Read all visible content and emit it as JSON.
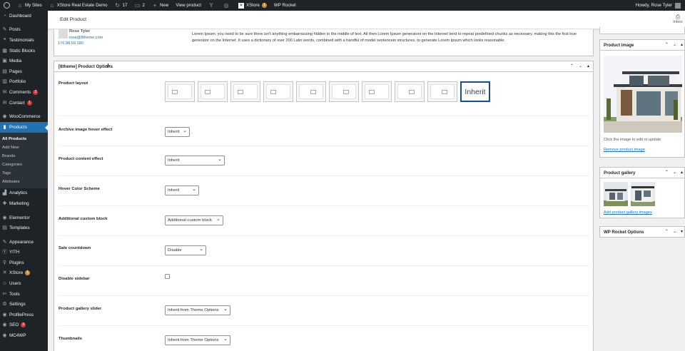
{
  "adminbar": {
    "my_sites": "My Sites",
    "site_name": "XStore Real Estate Demo",
    "updates": "17",
    "comments": "2",
    "new": "New",
    "view_product": "View product",
    "xstore": "XStore",
    "xstore_badge": "1",
    "wp_rocket": "WP Rocket",
    "howdy": "Howdy, Rose Tyler"
  },
  "sidebar": {
    "items": [
      {
        "label": "Dashboard",
        "icon": "dashboard-icon",
        "glyph": "◔"
      },
      {
        "label": "Posts",
        "icon": "pin-icon",
        "glyph": "✎"
      },
      {
        "label": "Testimonials",
        "icon": "quote-icon",
        "glyph": "❝"
      },
      {
        "label": "Static Blocks",
        "icon": "blocks-icon",
        "glyph": "▦"
      },
      {
        "label": "Media",
        "icon": "media-icon",
        "glyph": "▣"
      },
      {
        "label": "Pages",
        "icon": "pages-icon",
        "glyph": "▤"
      },
      {
        "label": "Portfolio",
        "icon": "portfolio-icon",
        "glyph": "▥"
      },
      {
        "label": "Comments",
        "icon": "comments-icon",
        "glyph": "✉",
        "badge": "2"
      },
      {
        "label": "Contact",
        "icon": "contact-icon",
        "glyph": "✉",
        "badge": "1"
      },
      {
        "label": "WooCommerce",
        "icon": "woocommerce-icon",
        "glyph": "◉"
      },
      {
        "label": "Products",
        "icon": "products-icon",
        "glyph": "▮"
      }
    ],
    "submenu": [
      "All Products",
      "Add New",
      "Brands",
      "Categories",
      "Tags",
      "Attributes"
    ],
    "items2": [
      {
        "label": "Analytics",
        "icon": "analytics-icon",
        "glyph": "▟"
      },
      {
        "label": "Marketing",
        "icon": "marketing-icon",
        "glyph": "✚"
      },
      {
        "label": "Elementor",
        "icon": "elementor-icon",
        "glyph": "◉"
      },
      {
        "label": "Templates",
        "icon": "templates-icon",
        "glyph": "▤"
      },
      {
        "label": "Appearance",
        "icon": "appearance-icon",
        "glyph": "✎"
      },
      {
        "label": "YITH",
        "icon": "yith-icon",
        "glyph": "Ⓨ"
      },
      {
        "label": "Plugins",
        "icon": "plugins-icon",
        "glyph": "⚲"
      },
      {
        "label": "XStore",
        "icon": "xstore-icon",
        "glyph": "✕",
        "badge": "1"
      },
      {
        "label": "Users",
        "icon": "users-icon",
        "glyph": "☺"
      },
      {
        "label": "Tools",
        "icon": "tools-icon",
        "glyph": "✄"
      },
      {
        "label": "Settings",
        "icon": "settings-icon",
        "glyph": "⚙"
      },
      {
        "label": "ProfilePress",
        "icon": "profilepress-icon",
        "glyph": "◉"
      },
      {
        "label": "SEO",
        "icon": "seo-icon",
        "glyph": "◉",
        "badge": "3"
      },
      {
        "label": "MC4WP",
        "icon": "mc4wp-icon",
        "glyph": "◉"
      }
    ]
  },
  "topbar": {
    "title": "Edit Product",
    "inbox": "Inbox"
  },
  "review": {
    "name": "Rose Tyler",
    "email": "rose@8theme.com",
    "ip": "176.98.69.180",
    "text": "Lorem Ipsum, you need to be sure there isn't anything embarrassing hidden in the middle of text. All then Lorem Ipsum generators on the Internet tend to repeat predefined chunks as necessary, making this the first true generator on the Internet. It uses a dictionary of over 200 Latin words, combined with a handful of model sentencein structures, to generate Lorem Ipsum which looks reasonable."
  },
  "options": {
    "title": "[8theme] Product Options",
    "product_layout": "Product layout",
    "layout_selected": "Inherit",
    "hover_effect": "Archive image hover effect",
    "hover_effect_value": "Inherit",
    "content_effect": "Product content effect",
    "content_effect_value": "Inherit",
    "color_scheme": "Hover Color Scheme",
    "color_scheme_value": "Inherit",
    "custom_block": "Additional custom block",
    "custom_block_value": "Additional custom block",
    "countdown": "Sale countdown",
    "countdown_value": "Disable",
    "disable_sidebar": "Disable sidebar",
    "gallery_slider": "Product gallery slider",
    "gallery_slider_value": "Inherit from Theme Options",
    "thumbnails": "Thumbnails",
    "thumbnails_value": "Inherit from Theme Options"
  },
  "right": {
    "product_image": "Product image",
    "image_note": "Click the image to edit or update",
    "remove_image": "Remove product image",
    "gallery": "Product gallery",
    "add_gallery": "Add product gallery images",
    "wp_rocket": "WP Rocket Options"
  }
}
